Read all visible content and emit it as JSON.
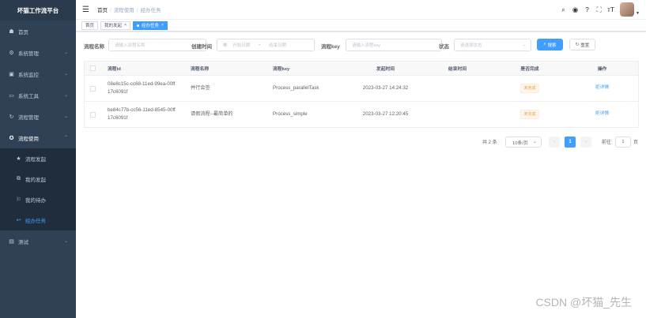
{
  "app": {
    "title": "坏猫工作流平台"
  },
  "sidebar": {
    "items": [
      {
        "label": "首页",
        "icon": "dashboard-icon",
        "glyph": "☗"
      },
      {
        "label": "系统管理",
        "icon": "system-icon",
        "glyph": "⚙"
      },
      {
        "label": "系统监控",
        "icon": "monitor-icon",
        "glyph": "▣"
      },
      {
        "label": "系统工具",
        "icon": "tool-icon",
        "glyph": "▭"
      },
      {
        "label": "流程管理",
        "icon": "flow-manage-icon",
        "glyph": "↻"
      },
      {
        "label": "流程使用",
        "icon": "flow-use-icon",
        "glyph": "✪"
      }
    ],
    "submenu": [
      {
        "label": "流程发起",
        "icon": "star-icon",
        "glyph": "★"
      },
      {
        "label": "我的发起",
        "icon": "external-link-icon",
        "glyph": "⧉"
      },
      {
        "label": "我的待办",
        "icon": "user-task-icon",
        "glyph": "⚐"
      },
      {
        "label": "经办任务",
        "icon": "back-arrow-icon",
        "glyph": "↩"
      }
    ],
    "last": {
      "label": "测试",
      "icon": "test-icon",
      "glyph": "▤"
    }
  },
  "navbar": {
    "breadcrumb": [
      "首页",
      "流程使用",
      "经办任务"
    ],
    "icons": [
      {
        "name": "search-icon",
        "glyph": "⌕"
      },
      {
        "name": "github-icon",
        "glyph": "◉"
      },
      {
        "name": "help-icon",
        "glyph": "?"
      },
      {
        "name": "fullscreen-icon",
        "glyph": "⛶"
      },
      {
        "name": "font-size-icon",
        "glyph": "ᴛT"
      }
    ]
  },
  "tags": [
    {
      "label": "首页",
      "active": false,
      "closable": false
    },
    {
      "label": "我的发起",
      "active": false,
      "closable": true
    },
    {
      "label": "经办任务",
      "active": true,
      "closable": true
    }
  ],
  "filters": {
    "name_label": "流程名称",
    "name_placeholder": "请输入流程名称",
    "time_label": "创建时间",
    "start_placeholder": "开始日期",
    "range_sep": "-",
    "end_placeholder": "结束日期",
    "key_label": "流程key",
    "key_placeholder": "请输入流程key",
    "status_label": "状态",
    "status_placeholder": "请选择状态",
    "search_label": "搜索",
    "reset_label": "重置"
  },
  "table": {
    "headers": [
      "流程id",
      "流程名称",
      "流程key",
      "发起时间",
      "结束时间",
      "是否完成",
      "操作"
    ],
    "rows": [
      {
        "id_line1": "08e8c15c-cc68-11ed-99ea-00ff",
        "id_line2": "17c6091f",
        "name": "并行会签",
        "key": "Process_parallelTask",
        "start": "2023-03-27 14:24:32",
        "end": "",
        "status": "未完成",
        "action": "拒详情"
      },
      {
        "id_line1": "be84c77b-cc56-11ed-8545-00ff",
        "id_line2": "17c6091f",
        "name": "请假流程--最简单的",
        "key": "Process_simple",
        "start": "2023-03-27 12:20:45",
        "end": "",
        "status": "未完成",
        "action": "拒详情"
      }
    ]
  },
  "pagination": {
    "total": "共 2 条",
    "page_size": "10条/页",
    "current": "1",
    "goto_label": "前往",
    "goto_value": "1",
    "page_unit": "页",
    "prev": "‹",
    "next": "›"
  },
  "watermark": "CSDN @坏猫_先生",
  "colors": {
    "sidebar_bg": "#304156",
    "primary": "#409eff",
    "warning": "#e6a23c"
  }
}
